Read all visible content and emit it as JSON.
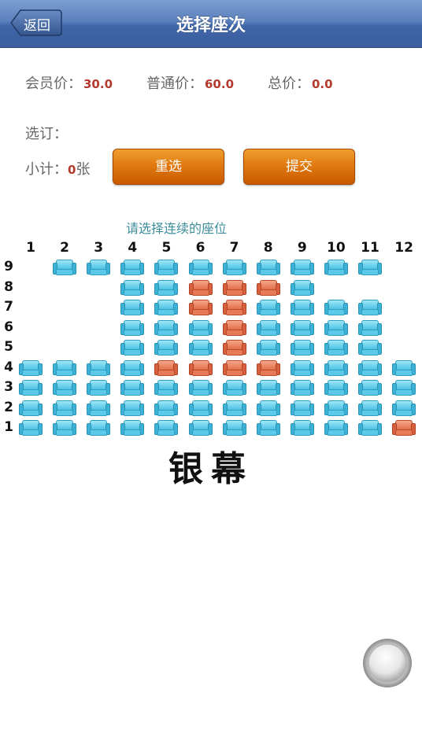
{
  "header": {
    "back_label": "返回",
    "title": "选择座次"
  },
  "prices": {
    "member_label": "会员价：",
    "member_value": "30.0",
    "normal_label": "普通价：",
    "normal_value": "60.0",
    "total_label": "总价：",
    "total_value": "0.0"
  },
  "selection": {
    "selected_label": "选订：",
    "subtotal_label": "小计：",
    "subtotal_count": "0",
    "subtotal_unit": "张"
  },
  "buttons": {
    "reset_label": "重选",
    "submit_label": "提交"
  },
  "seat_map": {
    "hint": "请选择连续的座位",
    "columns": [
      "1",
      "2",
      "3",
      "4",
      "5",
      "6",
      "7",
      "8",
      "9",
      "10",
      "11",
      "12"
    ],
    "rows": [
      {
        "label": "9",
        "seats": [
          "",
          "A",
          "A",
          "A",
          "A",
          "A",
          "A",
          "A",
          "A",
          "A",
          "A",
          ""
        ]
      },
      {
        "label": "8",
        "seats": [
          "",
          "",
          "",
          "A",
          "A",
          "S",
          "S",
          "S",
          "A",
          "",
          "",
          ""
        ]
      },
      {
        "label": "7",
        "seats": [
          "",
          "",
          "",
          "A",
          "A",
          "S",
          "S",
          "A",
          "A",
          "A",
          "A",
          ""
        ]
      },
      {
        "label": "6",
        "seats": [
          "",
          "",
          "",
          "A",
          "A",
          "A",
          "S",
          "A",
          "A",
          "A",
          "A",
          ""
        ]
      },
      {
        "label": "5",
        "seats": [
          "",
          "",
          "",
          "A",
          "A",
          "A",
          "S",
          "A",
          "A",
          "A",
          "A",
          ""
        ]
      },
      {
        "label": "4",
        "seats": [
          "A",
          "A",
          "A",
          "A",
          "S",
          "S",
          "S",
          "S",
          "A",
          "A",
          "A",
          "A"
        ]
      },
      {
        "label": "3",
        "seats": [
          "A",
          "A",
          "A",
          "A",
          "A",
          "A",
          "A",
          "A",
          "A",
          "A",
          "A",
          "A"
        ]
      },
      {
        "label": "2",
        "seats": [
          "A",
          "A",
          "A",
          "A",
          "A",
          "A",
          "A",
          "A",
          "A",
          "A",
          "A",
          "A"
        ]
      },
      {
        "label": "1",
        "seats": [
          "A",
          "A",
          "A",
          "A",
          "A",
          "A",
          "A",
          "A",
          "A",
          "A",
          "A",
          "S"
        ]
      }
    ],
    "screen_label": "银幕"
  },
  "colors": {
    "available": "#45bfe2",
    "sold": "#e06a45",
    "button": "#e07a10",
    "titlebar": "#4a70b0"
  }
}
